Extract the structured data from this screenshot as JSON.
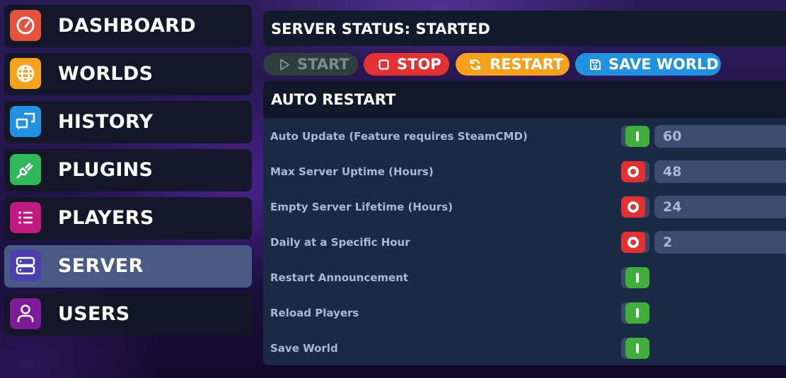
{
  "sidebar": {
    "items": [
      {
        "label": "DASHBOARD",
        "icon": "gauge-icon",
        "color": "#e5533d"
      },
      {
        "label": "WORLDS",
        "icon": "globe-icon",
        "color": "#f5a11a"
      },
      {
        "label": "HISTORY",
        "icon": "chat-bubbles-icon",
        "color": "#2191e2"
      },
      {
        "label": "PLUGINS",
        "icon": "plug-icon",
        "color": "#2fb85a"
      },
      {
        "label": "PLAYERS",
        "icon": "list-icon",
        "color": "#c2197e"
      },
      {
        "label": "SERVER",
        "icon": "server-icon",
        "color": "#4b3fb0",
        "active": true
      },
      {
        "label": "USERS",
        "icon": "user-icon",
        "color": "#7f1a98"
      }
    ]
  },
  "status": {
    "title": "SERVER STATUS: STARTED"
  },
  "controls": {
    "start_label": "START",
    "stop_label": "STOP",
    "restart_label": "RESTART",
    "save_label": "SAVE WORLD"
  },
  "auto_restart": {
    "title": "AUTO RESTART",
    "rows": [
      {
        "label": "Auto Update (Feature requires SteamCMD)",
        "enabled": true,
        "value": "60"
      },
      {
        "label": "Max Server Uptime (Hours)",
        "enabled": false,
        "value": "48"
      },
      {
        "label": "Empty Server Lifetime (Hours)",
        "enabled": false,
        "value": "24"
      },
      {
        "label": "Daily at a Specific Hour",
        "enabled": false,
        "value": "2"
      },
      {
        "label": "Restart Announcement",
        "enabled": true
      },
      {
        "label": "Reload Players",
        "enabled": true
      },
      {
        "label": "Save World",
        "enabled": true
      }
    ]
  },
  "colors": {
    "toggle_on": "#3fae3a",
    "toggle_off": "#e43030",
    "stop": "#e53131",
    "restart": "#f5a11a",
    "save": "#2191e2"
  }
}
